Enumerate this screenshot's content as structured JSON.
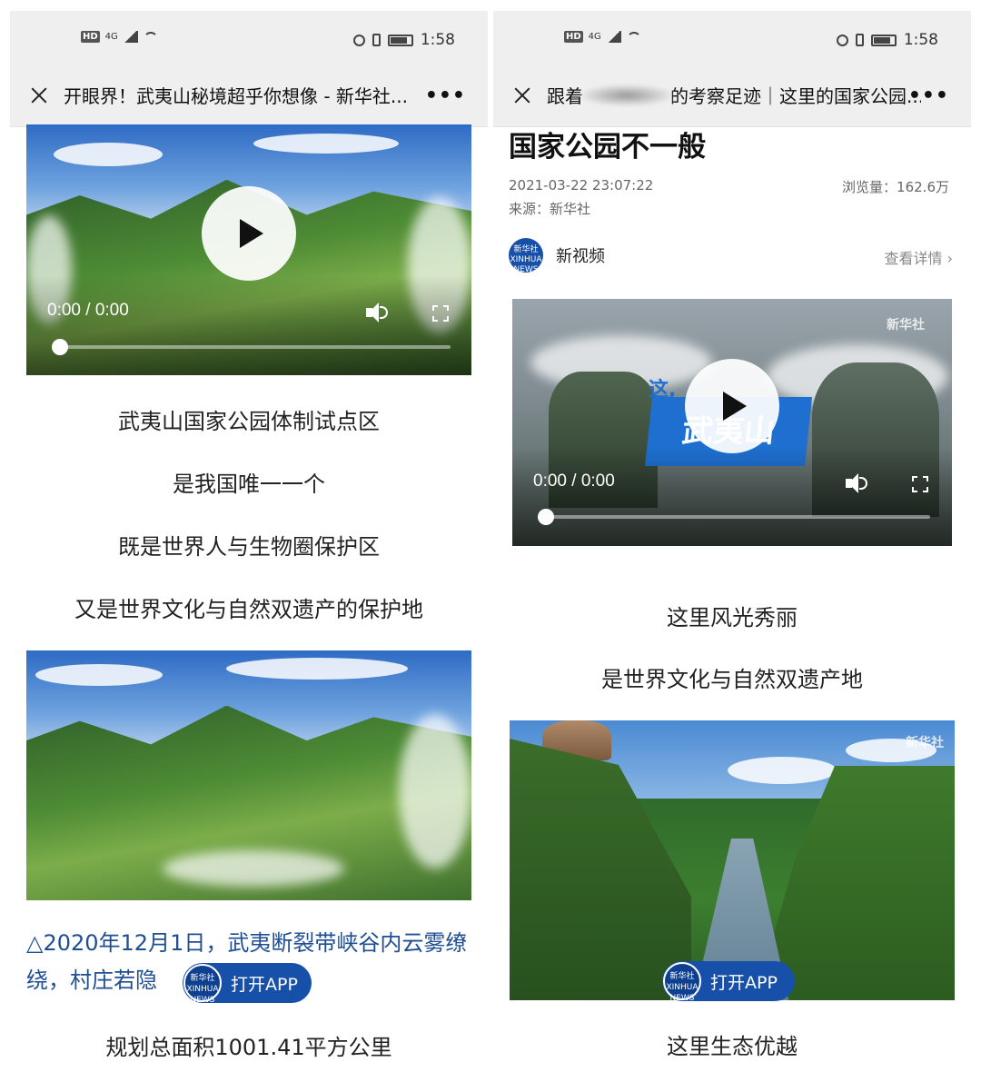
{
  "left": {
    "status": {
      "hd": "HD",
      "network": "4G",
      "time": "1:58"
    },
    "nav": {
      "title": "开眼界！武夷山秘境超乎你想像 - 新华社...",
      "more": "•••"
    },
    "video": {
      "time": "0:00 / 0:00",
      "progress": 0
    },
    "lines": [
      "武夷山国家公园体制试点区",
      "是我国唯一一个",
      "既是世界人与生物圈保护区",
      "又是世界文化与自然双遗产的保护地"
    ],
    "caption": "△2020年12月1日，武夷断裂带峡谷内云雾缭绕，村庄若隐",
    "open_app": {
      "logo": "新华社 XINHUA NEWS",
      "label": "打开APP"
    },
    "bottom_line": "规划总面积1001.41平方公里"
  },
  "right": {
    "status": {
      "hd": "HD",
      "network": "4G",
      "time": "1:58"
    },
    "nav": {
      "title_prefix": "跟着",
      "title_suffix": "的考察足迹｜这里的国家公园...",
      "more": "•••"
    },
    "headline": "国家公园不一般",
    "date": "2021-03-22 23:07:22",
    "views": "浏览量：162.6万",
    "source": "来源：新华社",
    "channel": {
      "logo": "新华社 XINHUA NEWS",
      "name": "新视频",
      "detail": "查看详情"
    },
    "video": {
      "time": "0:00 / 0:00",
      "progress": 0,
      "banner_big": "武夷山",
      "banner_small": "这,",
      "watermark": "新华社"
    },
    "lines": [
      "这里风光秀丽",
      "是世界文化与自然双遗产地"
    ],
    "image_watermark": "新华社",
    "open_app": {
      "logo": "新华社 XINHUA NEWS",
      "label": "打开APP"
    },
    "bottom_line": "这里生态优越"
  }
}
